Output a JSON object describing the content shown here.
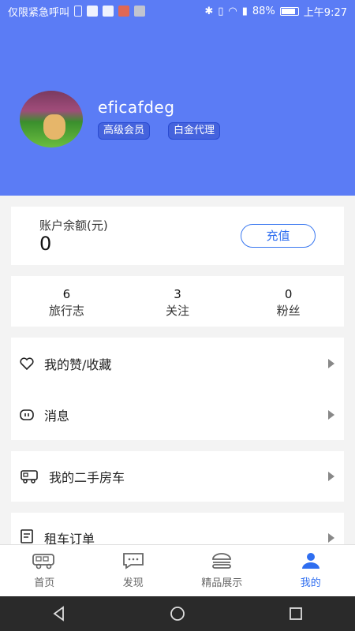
{
  "status_bar": {
    "left_text": "仅限紧急呼叫",
    "battery": "88%",
    "time": "上午9:27"
  },
  "profile": {
    "username": "eficafdeg",
    "badges": [
      "高级会员",
      "白金代理"
    ]
  },
  "balance": {
    "label": "账户余额(元)",
    "value": "0",
    "recharge_label": "充值"
  },
  "stats": [
    {
      "value": "6",
      "label": "旅行志"
    },
    {
      "value": "3",
      "label": "关注"
    },
    {
      "value": "0",
      "label": "粉丝"
    }
  ],
  "menu": {
    "likes": "我的赞/收藏",
    "messages": "消息",
    "used_rv": "我的二手房车",
    "rental_orders": "租车订单"
  },
  "bottom_nav": [
    {
      "label": "首页",
      "icon": "rv-icon"
    },
    {
      "label": "发现",
      "icon": "chat-icon"
    },
    {
      "label": "精品展示",
      "icon": "burger-icon"
    },
    {
      "label": "我的",
      "icon": "person-icon",
      "active": true
    }
  ],
  "colors": {
    "header": "#5b7cf5",
    "accent": "#2f6ef0"
  }
}
